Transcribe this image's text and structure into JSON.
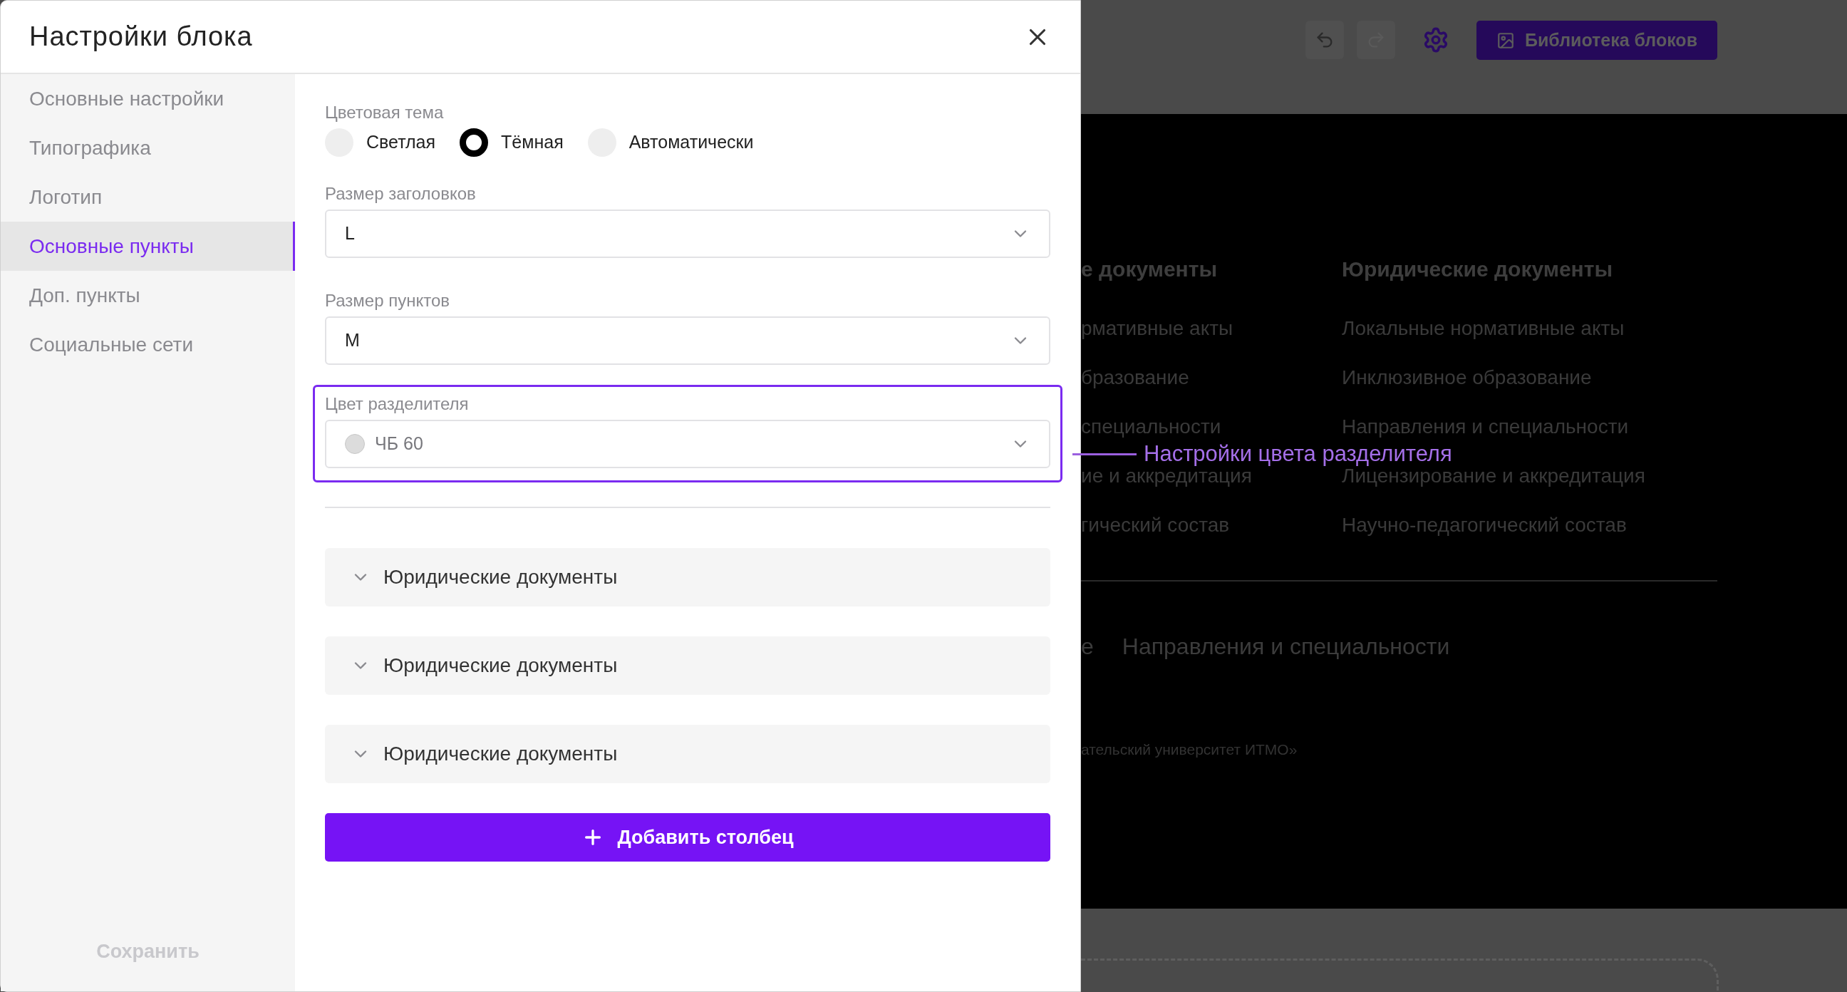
{
  "dialog": {
    "title": "Настройки блока"
  },
  "sidebar": {
    "items": [
      {
        "label": "Основные настройки",
        "selected": false
      },
      {
        "label": "Типографика",
        "selected": false
      },
      {
        "label": "Логотип",
        "selected": false
      },
      {
        "label": "Основные пункты",
        "selected": true
      },
      {
        "label": "Доп. пункты",
        "selected": false
      },
      {
        "label": "Социальные сети",
        "selected": false
      }
    ],
    "save_button": {
      "label": "Сохранить",
      "disabled": true
    }
  },
  "theme": {
    "label": "Цветовая тема",
    "options": [
      {
        "label": "Светлая",
        "selected": false
      },
      {
        "label": "Тёмная",
        "selected": true
      },
      {
        "label": "Автоматически",
        "selected": false
      }
    ]
  },
  "heading_size": {
    "label": "Размер заголовков",
    "value": "L"
  },
  "item_size": {
    "label": "Размер пунктов",
    "value": "M"
  },
  "divider_color": {
    "label": "Цвет разделителя",
    "value": "ЧБ 60",
    "highlighted": true
  },
  "sections": [
    {
      "title": "Юридические документы",
      "expanded": false
    },
    {
      "title": "Юридические документы",
      "expanded": false
    },
    {
      "title": "Юридические документы",
      "expanded": false
    }
  ],
  "add_column_button": "Добавить столбец",
  "annotation": {
    "text": "Настройки цвета разделителя"
  },
  "background_page": {
    "library_button": "Библиотека блоков",
    "columns": [
      {
        "heading": "е документы",
        "items": [
          "рмативные акты",
          "бразование",
          "специальности",
          "ие и аккредитация",
          "гический состав"
        ]
      },
      {
        "heading": "Юридические документы",
        "items": [
          "Локальные нормативные акты",
          "Инклюзивное образование",
          "Направления и специальности",
          "Лицензирование и аккредитация",
          "Научно-педагогический состав"
        ]
      }
    ],
    "bottom_links": [
      "е",
      "Направления и специальности"
    ],
    "copyright": "ательский университет ИТМО»"
  }
}
